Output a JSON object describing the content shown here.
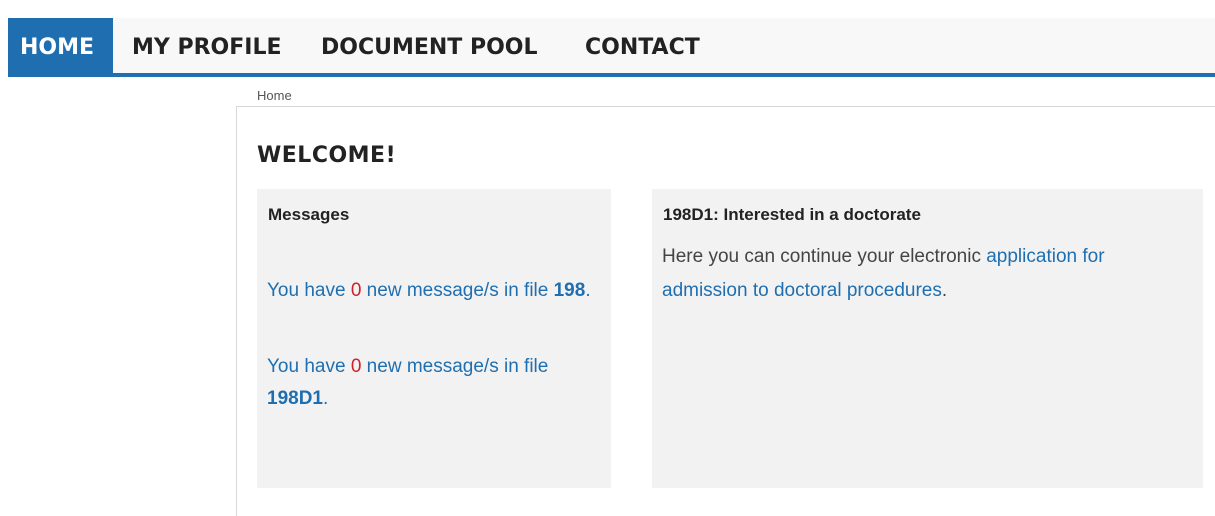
{
  "nav": {
    "home": "HOME",
    "profile": "MY PROFILE",
    "pool": "DOCUMENT POOL",
    "contact": "CONTACT"
  },
  "breadcrumb": "Home",
  "welcome": "WELCOME!",
  "messages_panel": {
    "title": "Messages",
    "items": [
      {
        "prefix": "You have ",
        "count": "0",
        "middle": " new message/s in file ",
        "file": "198",
        "suffix": "."
      },
      {
        "prefix": "You have ",
        "count": "0",
        "middle": " new message/s in file ",
        "file": "198D1",
        "suffix": "."
      }
    ]
  },
  "doctorate_panel": {
    "title": "198D1: Interested in a doctorate",
    "text_before": "Here you can continue your electronic ",
    "link": "application for admission to doctoral procedures",
    "text_after": "."
  },
  "colors": {
    "accent": "#1f6fb0",
    "count": "#d0202a",
    "panel_bg": "#f2f2f2"
  }
}
